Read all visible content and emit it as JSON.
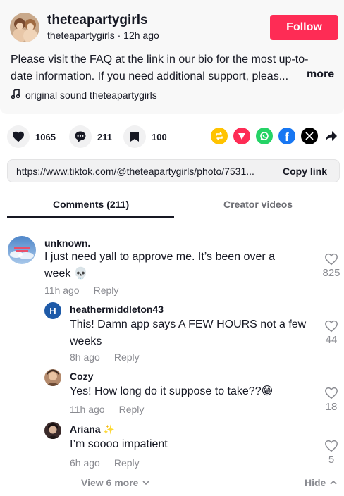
{
  "post": {
    "username": "theteapartygirls",
    "handle": "theteapartygirls",
    "time_ago": "12h ago",
    "follow_label": "Follow",
    "caption_line1": "Please visit the FAQ at the link in our bio for the most up-to-",
    "caption_line2": "date information. If you need additional support, pleas...",
    "more_label": "more",
    "sound": "original sound theteapartygirls"
  },
  "actions": {
    "likes": "1065",
    "comments": "211",
    "saves": "100"
  },
  "share": {
    "repost_color": "#ffc300",
    "send_color": "#fe2c55",
    "whatsapp_color": "#25d366",
    "facebook_color": "#1877f2",
    "x_color": "#000000"
  },
  "link": {
    "url": "https://www.tiktok.com/@theteapartygirls/photo/7531...",
    "copy_label": "Copy link"
  },
  "tabs": {
    "comments": "Comments (211)",
    "creator_videos": "Creator videos"
  },
  "comments": [
    {
      "user": "unknown.",
      "text_line1": "I just need yall to approve me. It’s been over a",
      "text_line2": "week 💀",
      "time": "11h ago",
      "reply": "Reply",
      "likes": "825"
    },
    {
      "user": "heathermiddleton43",
      "avatar_letter": "H",
      "text_line1": "This! Damn app says A FEW HOURS not a few",
      "text_line2": "weeks",
      "time": "8h ago",
      "reply": "Reply",
      "likes": "44"
    },
    {
      "user": "Cozy",
      "text_line1": "Yes! How long do it suppose to take??😁",
      "time": "11h ago",
      "reply": "Reply",
      "likes": "18"
    },
    {
      "user": "Ariana",
      "user_suffix": "✨",
      "text_line1": "I’m soooo impatient",
      "time": "6h ago",
      "reply": "Reply",
      "likes": "5"
    }
  ],
  "replies_footer": {
    "view_more": "View 6 more",
    "hide": "Hide"
  }
}
